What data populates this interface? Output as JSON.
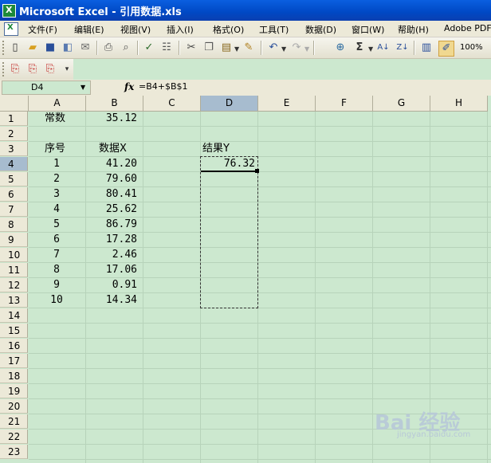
{
  "window": {
    "title": "Microsoft Excel - 引用数据.xls"
  },
  "menu": [
    "文件(F)",
    "编辑(E)",
    "视图(V)",
    "插入(I)",
    "格式(O)",
    "工具(T)",
    "数据(D)",
    "窗口(W)",
    "帮助(H)",
    "Adobe PDF"
  ],
  "toolbar": {
    "zoom": "100%"
  },
  "formula_bar": {
    "name_box": "D4",
    "fx_label": "fx",
    "formula": "=B4+$B$1"
  },
  "columns": [
    "A",
    "B",
    "C",
    "D",
    "E",
    "F",
    "G",
    "H"
  ],
  "selected_column": "D",
  "rows": [
    "1",
    "2",
    "3",
    "4",
    "5",
    "6",
    "7",
    "8",
    "9",
    "10",
    "11",
    "12",
    "13",
    "14",
    "15",
    "16",
    "17",
    "18",
    "19",
    "20",
    "21",
    "22",
    "23"
  ],
  "cells": {
    "A1": "常数",
    "B1": "35.12",
    "A3": "序号",
    "B3": "数据X",
    "D3": "结果Y",
    "A4": "1",
    "B4": "41.20",
    "D4": "76.32",
    "A5": "2",
    "B5": "79.60",
    "A6": "3",
    "B6": "80.41",
    "A7": "4",
    "B7": "25.62",
    "A8": "5",
    "B8": "86.79",
    "A9": "6",
    "B9": "17.28",
    "A10": "7",
    "B10": "2.46",
    "A11": "8",
    "B11": "17.06",
    "A12": "9",
    "B12": "0.91",
    "A13": "10",
    "B13": "14.34"
  },
  "watermark": {
    "brand": "Bai 经验",
    "url": "jingyan.baidu.com"
  }
}
